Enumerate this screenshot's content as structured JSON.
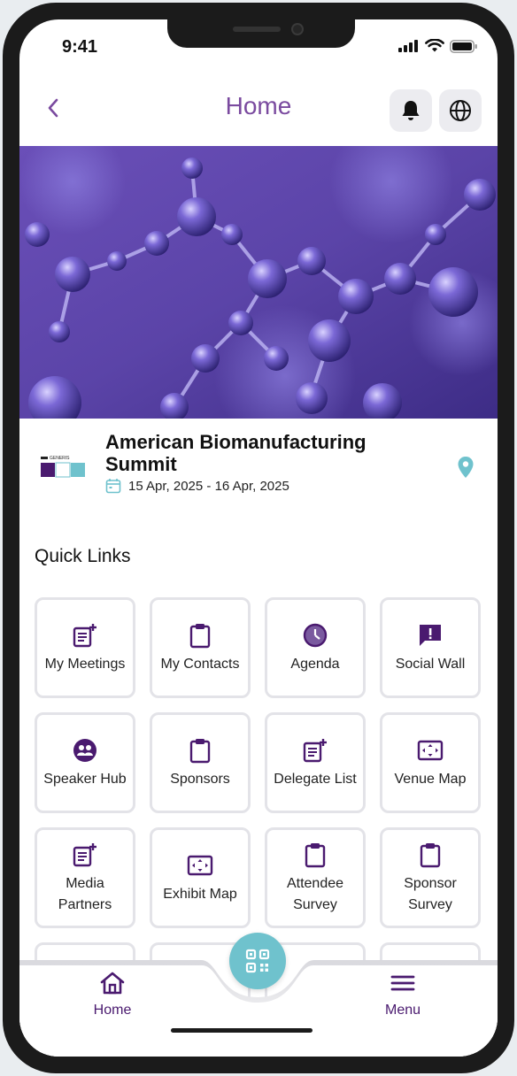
{
  "status": {
    "time": "9:41"
  },
  "header": {
    "title": "Home"
  },
  "event": {
    "logo_text_top": "GENERIS",
    "logo_text_main": "BIO",
    "title": "American Biomanufacturing Summit",
    "dates": "15 Apr, 2025 - 16 Apr, 2025"
  },
  "quick_links": {
    "heading": "Quick Links",
    "tiles": [
      {
        "label": "My Meetings",
        "icon": "note-plus-icon"
      },
      {
        "label": "My Contacts",
        "icon": "clipboard-icon"
      },
      {
        "label": "Agenda",
        "icon": "clock-icon"
      },
      {
        "label": "Social Wall",
        "icon": "alert-message-icon"
      },
      {
        "label": "Speaker Hub",
        "icon": "group-icon"
      },
      {
        "label": "Sponsors",
        "icon": "clipboard-icon"
      },
      {
        "label": "Delegate List",
        "icon": "note-plus-icon"
      },
      {
        "label": "Venue Map",
        "icon": "map-frame-icon"
      },
      {
        "label": "Media Partners",
        "icon": "note-plus-icon"
      },
      {
        "label": "Exhibit Map",
        "icon": "map-frame-icon"
      },
      {
        "label": "Attendee Survey",
        "icon": "clipboard-icon"
      },
      {
        "label": "Sponsor Survey",
        "icon": "clipboard-icon"
      }
    ]
  },
  "bottom_nav": {
    "home_label": "Home",
    "menu_label": "Menu"
  },
  "colors": {
    "accent": "#7a4a9f",
    "icon": "#4a1a6f",
    "teal": "#6fc2cd"
  }
}
